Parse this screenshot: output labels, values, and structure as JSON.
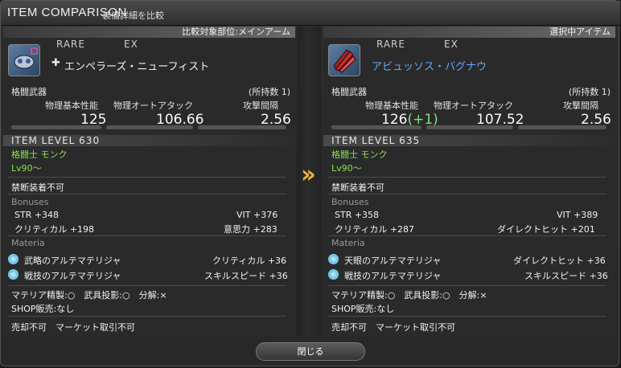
{
  "window": {
    "title": "ITEM COMPARISON",
    "subtitle": "装備詳細を比較"
  },
  "left": {
    "header": "比較対象部位:メインアーム",
    "rarity": "RARE",
    "ex": "EX",
    "name": "エンペラーズ・ニューフィスト",
    "category": "格闘武器",
    "owned": "(所持数 1)",
    "stats": {
      "label1": "物理基本性能",
      "value1": "125",
      "bonus1": "",
      "label2": "物理オートアタック",
      "value2": "106.66",
      "label3": "攻撃間隔",
      "value3": "2.56"
    },
    "item_level": "ITEM LEVEL 630",
    "job": "格闘士 モンク",
    "level": "Lv90～",
    "restriction": "禁断装着不可",
    "bonuses_title": "Bonuses",
    "bonuses": [
      "STR +348",
      "VIT +376",
      "クリティカル +198",
      "意思力 +283"
    ],
    "materia_title": "Materia",
    "materia": [
      {
        "name": "武略のアルテマテリジャ",
        "effect": "クリティカル +36"
      },
      {
        "name": "戦技のアルテマテリジャ",
        "effect": "スキルスピード +36"
      }
    ],
    "crafting": "マテリア精製:○　武具投影:○　分解:×",
    "shop": "SHOP販売:なし",
    "trade": "売却不可　マーケット取引不可"
  },
  "right": {
    "header": "選択中アイテム",
    "rarity": "RARE",
    "ex": "EX",
    "name": "アビュッソス・バグナウ",
    "category": "格闘武器",
    "owned": "(所持数 1)",
    "stats": {
      "label1": "物理基本性能",
      "value1": "126",
      "bonus1": "(+1)",
      "label2": "物理オートアタック",
      "value2": "107.52",
      "label3": "攻撃間隔",
      "value3": "2.56"
    },
    "item_level": "ITEM LEVEL 635",
    "job": "格闘士 モンク",
    "level": "Lv90～",
    "restriction": "禁断装着不可",
    "bonuses_title": "Bonuses",
    "bonuses": [
      "STR +358",
      "VIT +389",
      "クリティカル +287",
      "ダイレクトヒット +201"
    ],
    "materia_title": "Materia",
    "materia": [
      {
        "name": "天眼のアルテマテリジャ",
        "effect": "ダイレクトヒット +36"
      },
      {
        "name": "戦技のアルテマテリジャ",
        "effect": "スキルスピード +36"
      }
    ],
    "crafting": "マテリア精製:○　武具投影:○　分解:×",
    "shop": "SHOP販売:なし",
    "trade": "売却不可　マーケット取引不可"
  },
  "close_label": "閉じる",
  "arrow_icon": "double-chevron-right-icon",
  "colors": {
    "accent": "#e8b040",
    "job": "#8be05a",
    "selected_name": "#6aa6ff"
  }
}
